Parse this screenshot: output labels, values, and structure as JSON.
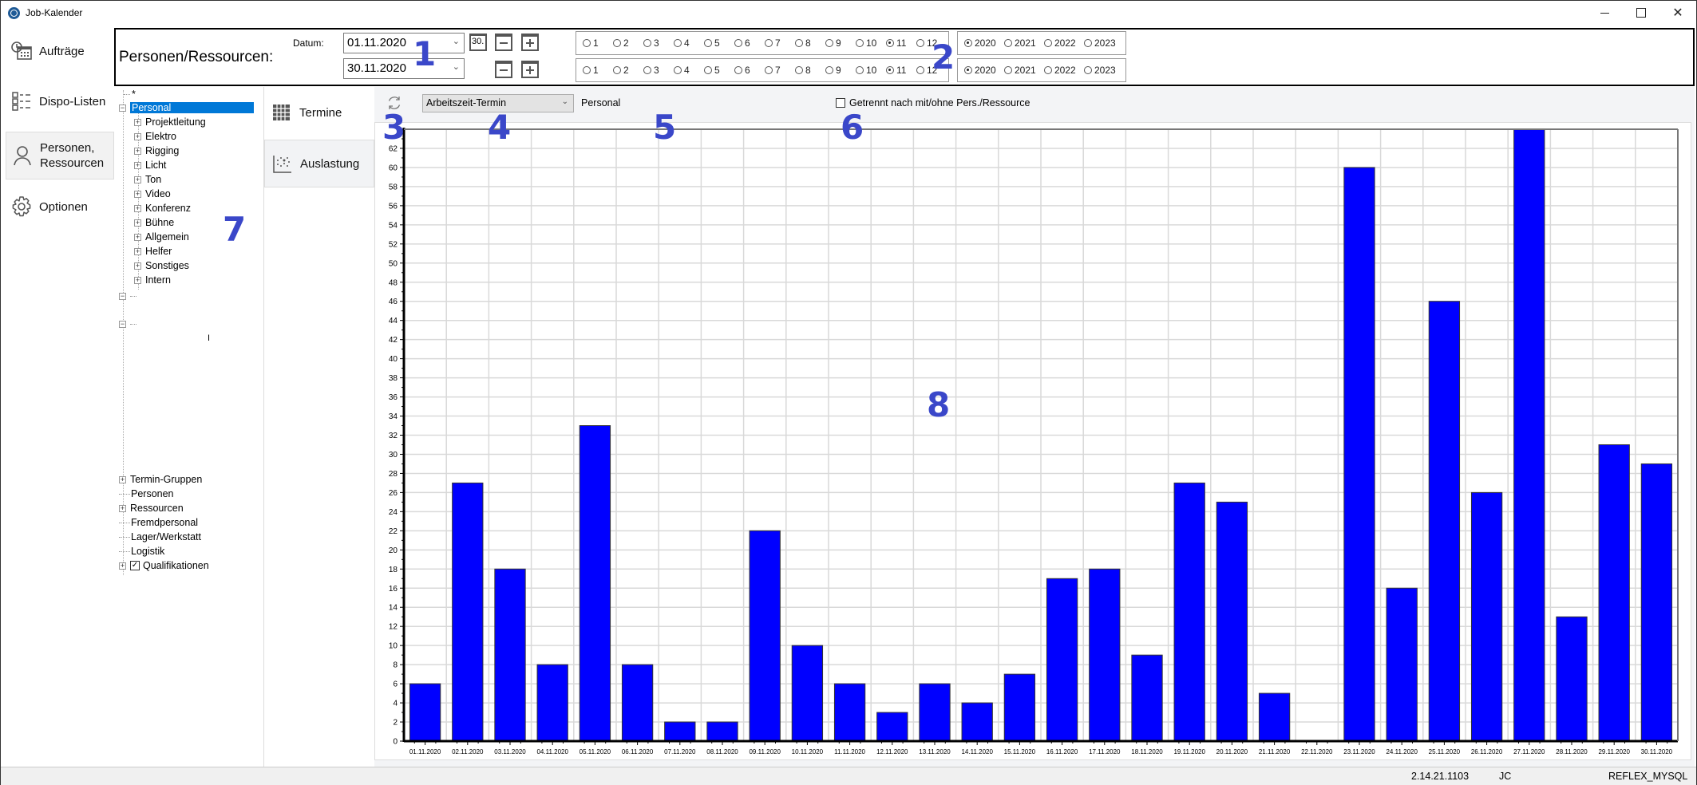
{
  "window": {
    "title": "Job-Kalender",
    "controls": {
      "minimize": "minimize",
      "maximize": "maximize",
      "close": "✕"
    }
  },
  "nav": {
    "items": [
      {
        "label": "Aufträge",
        "icon": "calendar-clock-icon"
      },
      {
        "label": "Dispo-Listen",
        "icon": "list-icon"
      },
      {
        "label": "Personen,\nRessourcen",
        "label1": "Personen,",
        "label2": "Ressourcen",
        "icon": "person-icon",
        "active": true
      },
      {
        "label": "Optionen",
        "icon": "gear-icon"
      }
    ]
  },
  "header": {
    "title": "Personen/Ressourcen:",
    "datum_label": "Datum:",
    "date_from": "01.11.2020",
    "date_to": "30.11.2020",
    "today_button": "30.",
    "months": [
      "1",
      "2",
      "3",
      "4",
      "5",
      "6",
      "7",
      "8",
      "9",
      "10",
      "11",
      "12"
    ],
    "month_from_selected": "11",
    "month_to_selected": "11",
    "years": [
      "2020",
      "2021",
      "2022",
      "2023"
    ],
    "year_from_selected": "2020",
    "year_to_selected": "2020"
  },
  "tree": {
    "root_marker": "*",
    "personal": {
      "label": "Personal",
      "children": [
        "Projektleitung",
        "Elektro",
        "Rigging",
        "Licht",
        "Ton",
        "Video",
        "Konferenz",
        "Bühne",
        "Allgemein",
        "Helfer",
        "Sonstiges",
        "Intern"
      ]
    },
    "cursor_mark": "I",
    "bottom_items": [
      {
        "label": "Termin-Gruppen",
        "expandable": true
      },
      {
        "label": "Personen",
        "expandable": false
      },
      {
        "label": "Ressourcen",
        "expandable": true
      },
      {
        "label": "Fremdpersonal",
        "expandable": false
      },
      {
        "label": "Lager/Werkstatt",
        "expandable": false
      },
      {
        "label": "Logistik",
        "expandable": false
      },
      {
        "label": "Qualifikationen",
        "expandable": true,
        "checked": true
      }
    ]
  },
  "view_tabs": [
    {
      "label": "Termine",
      "icon": "grid-icon"
    },
    {
      "label": "Auslastung",
      "icon": "scatter-chart-icon",
      "active": true
    }
  ],
  "toolbar": {
    "select_value": "Arbeitszeit-Termin",
    "context_label": "Personal",
    "checkbox_label": "Getrennt nach mit/ohne Pers./Ressource",
    "checkbox_checked": false
  },
  "annotations": [
    "1",
    "2",
    "3",
    "4",
    "5",
    "6",
    "7",
    "8"
  ],
  "statusbar": {
    "version": "2.14.21.1103",
    "user": "JC",
    "database": "REFLEX_MYSQL"
  },
  "colors": {
    "bar": "#0000ff",
    "selection": "#0078d7",
    "annotation": "#3a47c9"
  },
  "chart_data": {
    "type": "bar",
    "title": "",
    "xlabel": "",
    "ylabel": "",
    "ylim": [
      0,
      64
    ],
    "ytick_step": 2,
    "grid": true,
    "categories": [
      "01.11.2020",
      "02.11.2020",
      "03.11.2020",
      "04.11.2020",
      "05.11.2020",
      "06.11.2020",
      "07.11.2020",
      "08.11.2020",
      "09.11.2020",
      "10.11.2020",
      "11.11.2020",
      "12.11.2020",
      "13.11.2020",
      "14.11.2020",
      "15.11.2020",
      "16.11.2020",
      "17.11.2020",
      "18.11.2020",
      "19.11.2020",
      "20.11.2020",
      "21.11.2020",
      "22.11.2020",
      "23.11.2020",
      "24.11.2020",
      "25.11.2020",
      "26.11.2020",
      "27.11.2020",
      "28.11.2020",
      "29.11.2020",
      "30.11.2020"
    ],
    "values": [
      6,
      27,
      18,
      8,
      33,
      8,
      2,
      2,
      22,
      10,
      6,
      3,
      6,
      4,
      7,
      17,
      18,
      9,
      27,
      25,
      5,
      0,
      60,
      16,
      46,
      26,
      64,
      13,
      31,
      29
    ]
  }
}
